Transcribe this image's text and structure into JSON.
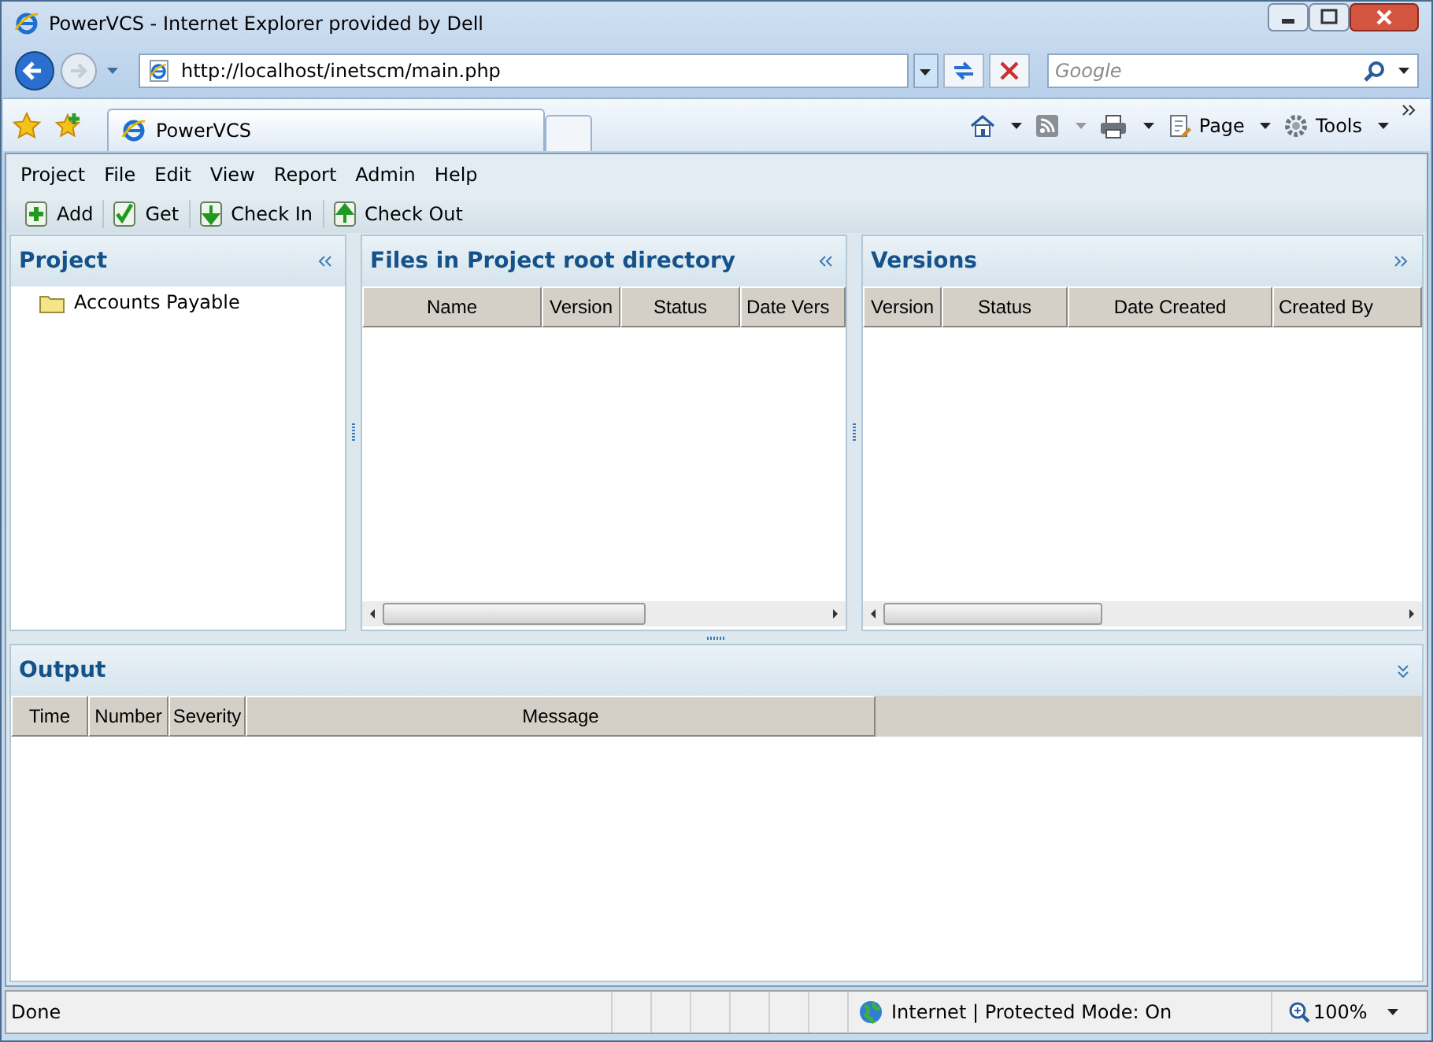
{
  "window": {
    "title": "PowerVCS - Internet Explorer provided by Dell"
  },
  "address_bar": {
    "url": "http://localhost/inetscm/main.php"
  },
  "search": {
    "placeholder": "Google"
  },
  "tabs": [
    {
      "label": "PowerVCS",
      "selected": true
    }
  ],
  "command_bar": [
    {
      "kind": "home"
    },
    {
      "kind": "feeds"
    },
    {
      "kind": "print"
    },
    {
      "kind": "page",
      "label": "Page"
    },
    {
      "kind": "tools",
      "label": "Tools"
    }
  ],
  "menu": [
    "Project",
    "File",
    "Edit",
    "View",
    "Report",
    "Admin",
    "Help"
  ],
  "toolbar": [
    {
      "kind": "add",
      "label": "Add"
    },
    {
      "kind": "get",
      "label": "Get"
    },
    {
      "kind": "checkin",
      "label": "Check In"
    },
    {
      "kind": "checkout",
      "label": "Check Out"
    }
  ],
  "project_panel": {
    "title": "Project",
    "tree": [
      {
        "label": "Accounts Payable"
      }
    ]
  },
  "files_panel": {
    "title": "Files in Project root directory",
    "columns": [
      "Name",
      "Version",
      "Status",
      "Date Vers"
    ]
  },
  "versions_panel": {
    "title": "Versions",
    "columns": [
      "Version",
      "Status",
      "Date Created",
      "Created By"
    ]
  },
  "output_panel": {
    "title": "Output",
    "columns": [
      "Time",
      "Number",
      "Severity",
      "Message"
    ]
  },
  "status_bar": {
    "text": "Done",
    "zone": "Internet | Protected Mode: On",
    "zoom": "100%"
  }
}
